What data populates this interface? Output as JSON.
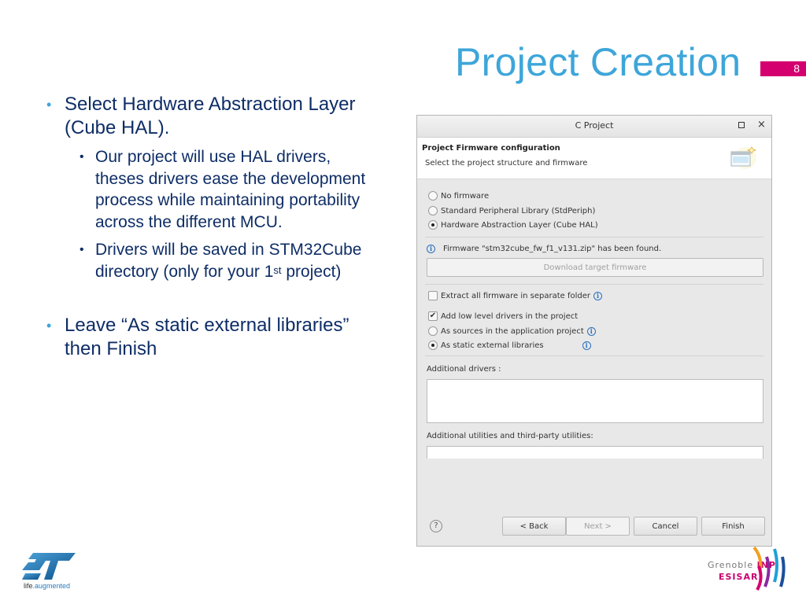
{
  "slide": {
    "title": "Project Creation",
    "page_number": "8",
    "bullets": {
      "main1": "Select Hardware Abstraction Layer (Cube HAL).",
      "sub1": "Our project will use HAL drivers, theses drivers ease the development process while maintaining portability across the different MCU.",
      "sub2_pre": "Drivers will be saved in STM32Cube directory (only for your 1",
      "sub2_sup": "st",
      "sub2_post": " project)",
      "main2": "Leave “As static external libraries” then Finish"
    }
  },
  "dialog": {
    "title": "C Project",
    "header_title": "Project Firmware configuration",
    "header_subtitle": "Select the project structure and firmware",
    "firmware_options": [
      {
        "label": "No firmware",
        "selected": false
      },
      {
        "label": "Standard Peripheral Library (StdPeriph)",
        "selected": false
      },
      {
        "label": "Hardware Abstraction Layer (Cube HAL)",
        "selected": true
      }
    ],
    "firmware_found": "Firmware \"stm32cube_fw_f1_v131.zip\" has been found.",
    "download_button": "Download target firmware",
    "extract_label": "Extract all firmware in separate folder",
    "extract_checked": false,
    "add_drivers_label": "Add low level drivers in the project",
    "add_drivers_checked": true,
    "driver_options": [
      {
        "label": "As sources in the application project",
        "selected": false
      },
      {
        "label": "As static external libraries",
        "selected": true
      }
    ],
    "additional_drivers_label": "Additional drivers :",
    "additional_utilities_label": "Additional utilities and third-party utilities:",
    "buttons": {
      "back": "< Back",
      "next": "Next >",
      "cancel": "Cancel",
      "finish": "Finish"
    }
  },
  "logos": {
    "st_tagline_1": "life",
    "st_tagline_2": ".augmented",
    "inp_1": "Grenoble ",
    "inp_2": "INP",
    "esisar": "ESISAR"
  },
  "colors": {
    "title": "#3ea6d9",
    "badge": "#d4006f",
    "body_text": "#0e2d66"
  }
}
